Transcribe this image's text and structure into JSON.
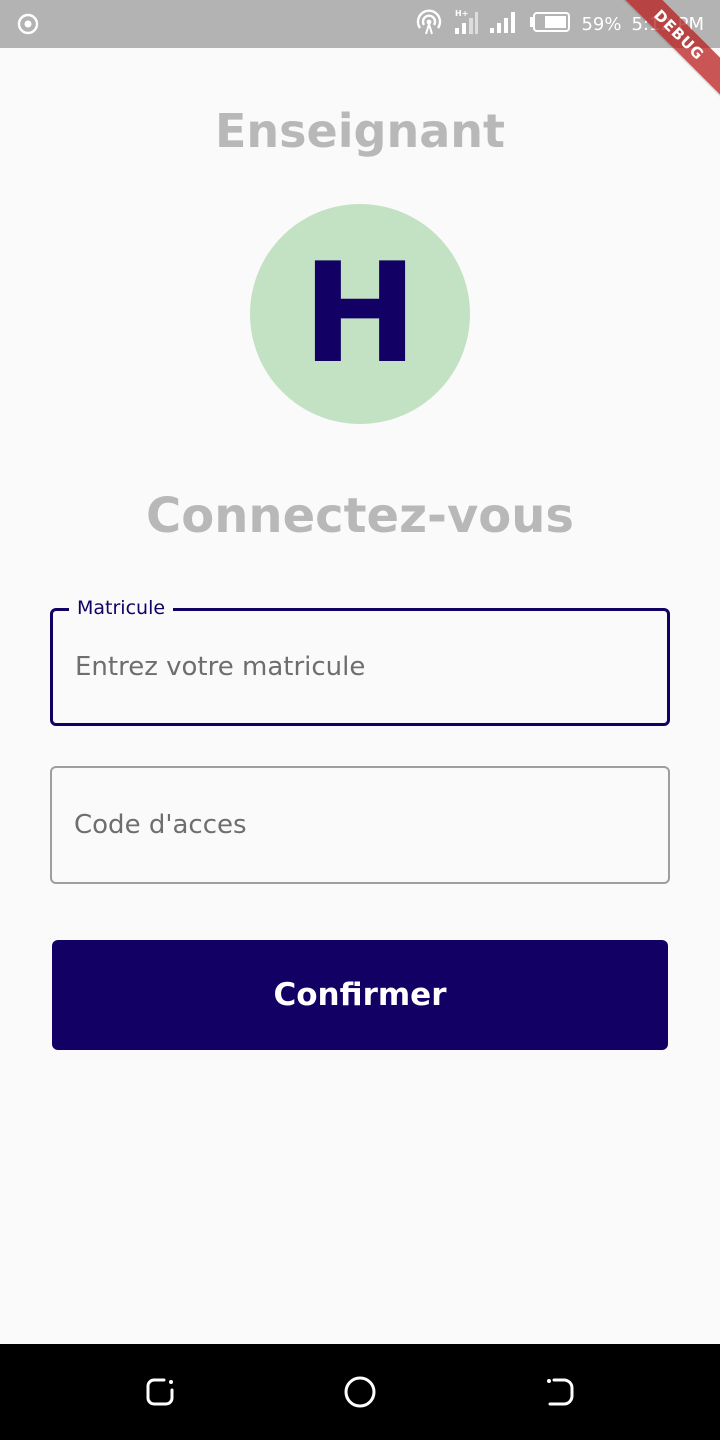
{
  "status_bar": {
    "battery_percent": "59%",
    "time": "5:12 PM",
    "icons": [
      "target-icon",
      "hotspot-icon",
      "signal-hplus-icon",
      "signal-icon",
      "battery-icon"
    ]
  },
  "debug_banner": "DEBUG",
  "screen": {
    "role_title": "Enseignant",
    "avatar_letter": "H",
    "title": "Connectez-vous"
  },
  "form": {
    "matricule": {
      "label": "Matricule",
      "placeholder": "Entrez votre matricule"
    },
    "code": {
      "placeholder": "Code d'acces"
    },
    "confirm_label": "Confirmer"
  },
  "nav_bar": {
    "buttons": [
      "recents-icon",
      "home-icon",
      "back-icon"
    ]
  },
  "colors": {
    "primary": "#120064",
    "avatar_bg": "#c3e1c3",
    "title_gray": "#b8b8b8",
    "background": "#fafafa",
    "status_bar": "#b3b3b3"
  }
}
